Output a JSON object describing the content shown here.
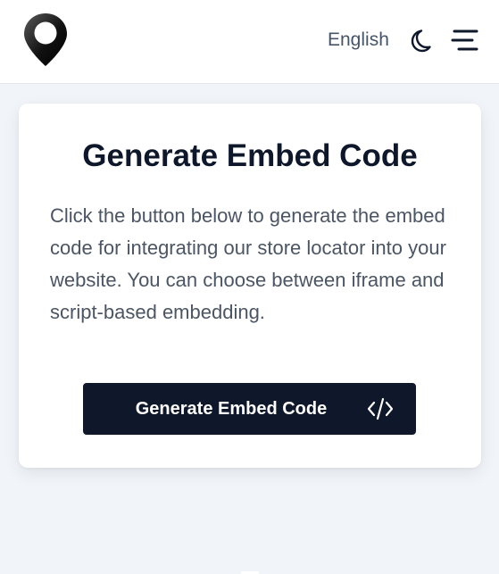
{
  "header": {
    "language_label": "English",
    "logo_icon": "map-pin-icon",
    "theme_icon": "moon-icon",
    "menu_icon": "hamburger-menu-icon"
  },
  "card": {
    "title": "Generate Embed Code",
    "description": "Click the button below to generate the embed code for integrating our store locator into your website. You can choose between iframe and script-based embedding.",
    "button_label": "Generate Embed Code",
    "button_icon": "code-icon"
  },
  "colors": {
    "page_background": "#f1f4f8",
    "card_background": "#ffffff",
    "primary": "#0f172a",
    "body_text": "#4b5563"
  }
}
